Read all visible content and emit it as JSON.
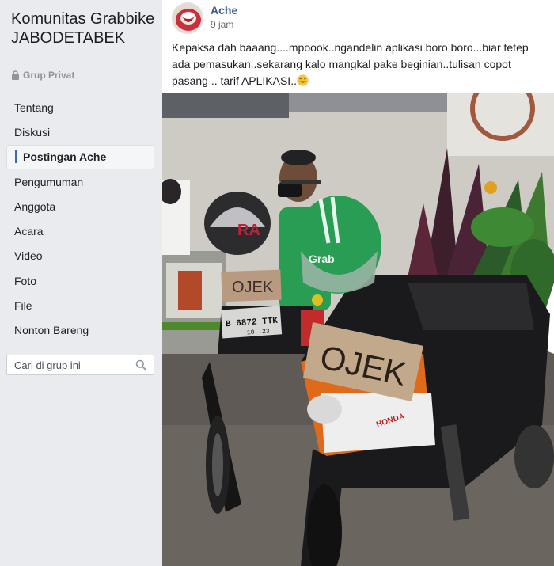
{
  "group": {
    "name": "Komunitas Grabbike JABODETABEK",
    "privacy": "Grup Privat"
  },
  "nav": {
    "items": [
      {
        "label": "Tentang"
      },
      {
        "label": "Diskusi"
      },
      {
        "label": "Postingan Ache"
      },
      {
        "label": "Pengumuman"
      },
      {
        "label": "Anggota"
      },
      {
        "label": "Acara"
      },
      {
        "label": "Video"
      },
      {
        "label": "Foto"
      },
      {
        "label": "File"
      },
      {
        "label": "Nonton Bareng"
      }
    ],
    "active_index": 2
  },
  "search": {
    "placeholder": "Cari di grup ini"
  },
  "post": {
    "author": "Ache",
    "time": "9 jam",
    "text": "Kepaksa dah baaang....mpoook..ngandelin aplikasi boro boro...biar tetep ada pemasukan..sekarang kalo mangkal pake beginian..tulisan copot pasang .. tarif APLIKASI..",
    "photo": {
      "sign_front": "OJEK",
      "sign_back": "OJEK",
      "helmet_text": "Grab",
      "plate": "B 6872 TTK",
      "plate_sub": "10 .23",
      "bike_brand": "HONDA",
      "helmet_red_text": "RA"
    }
  },
  "colors": {
    "link": "#385898",
    "accent": "#4267b2",
    "grab_green": "#2a9d55"
  }
}
